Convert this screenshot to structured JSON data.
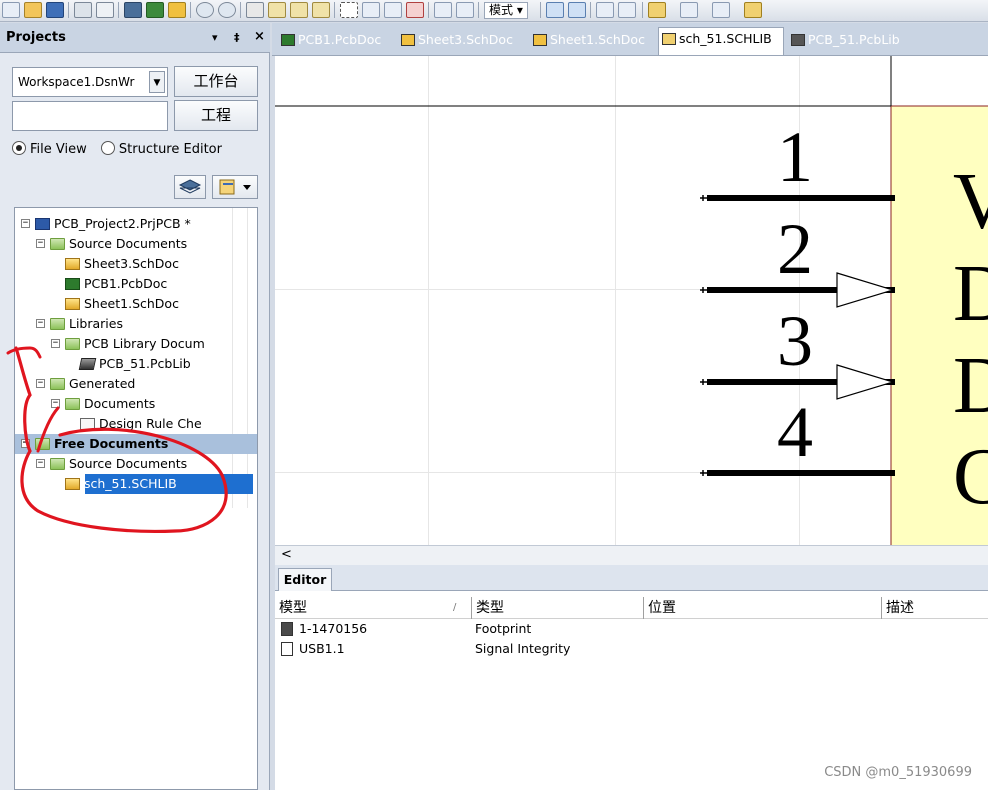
{
  "panel": {
    "title": "Projects",
    "ctrl_menu": "▾",
    "ctrl_pin": "‡",
    "ctrl_close": "×",
    "workspace_value": "Workspace1.DsnWr",
    "workspace_button": "工作台",
    "project_button": "工程",
    "radio_file_view": "File View",
    "radio_structure_editor": "Structure Editor",
    "view_mode": "file-view"
  },
  "tree": {
    "rows": [
      {
        "label": "PCB_Project2.PrjPCB *",
        "icon": "project-icon"
      },
      {
        "label": "Source Documents",
        "icon": "folder-icon"
      },
      {
        "label": "Sheet3.SchDoc",
        "icon": "schematic-doc-icon"
      },
      {
        "label": "PCB1.PcbDoc",
        "icon": "pcb-doc-icon"
      },
      {
        "label": "Sheet1.SchDoc",
        "icon": "schematic-doc-icon"
      },
      {
        "label": "Libraries",
        "icon": "folder-icon"
      },
      {
        "label": "PCB Library Docum",
        "icon": "folder-icon"
      },
      {
        "label": "PCB_51.PcbLib",
        "icon": "pcb-library-icon"
      },
      {
        "label": "Generated",
        "icon": "folder-icon"
      },
      {
        "label": "Documents",
        "icon": "folder-icon"
      },
      {
        "label": "Design Rule Che",
        "icon": "report-icon"
      },
      {
        "label": "Free Documents",
        "icon": "folder-icon"
      },
      {
        "label": "Source Documents",
        "icon": "folder-icon"
      },
      {
        "label": "sch_51.SCHLIB",
        "icon": "schematic-library-icon"
      }
    ]
  },
  "toolbar": {
    "mode_label": "模式"
  },
  "tabs": [
    {
      "label": "PCB1.PcbDoc",
      "icon": "pcb-doc-icon"
    },
    {
      "label": "Sheet3.SchDoc",
      "icon": "schematic-doc-icon"
    },
    {
      "label": "Sheet1.SchDoc",
      "icon": "schematic-doc-icon"
    },
    {
      "label": "sch_51.SCHLIB",
      "icon": "schematic-library-icon",
      "active": true
    },
    {
      "label": "PCB_51.PcbLib",
      "icon": "pcb-library-icon"
    }
  ],
  "schematic": {
    "pins": [
      {
        "number": "1",
        "label": "V"
      },
      {
        "number": "2",
        "label": "D"
      },
      {
        "number": "3",
        "label": "D"
      },
      {
        "number": "4",
        "label": "G"
      }
    ],
    "body_color": "#ffffc0",
    "pin_color": "#000000"
  },
  "scroll": {
    "left_arrow": "<"
  },
  "editor": {
    "tab_label": "Editor",
    "columns": [
      "模型",
      "类型",
      "位置",
      "描述"
    ],
    "sort_indicator": "/",
    "rows": [
      {
        "model": "1-1470156",
        "type": "Footprint",
        "icon": "footprint-icon"
      },
      {
        "model": "USB1.1",
        "type": "Signal Integrity",
        "icon": "signal-integrity-icon"
      }
    ]
  },
  "watermark": "CSDN @m0_51930699",
  "annotation_color": "#e0151f"
}
